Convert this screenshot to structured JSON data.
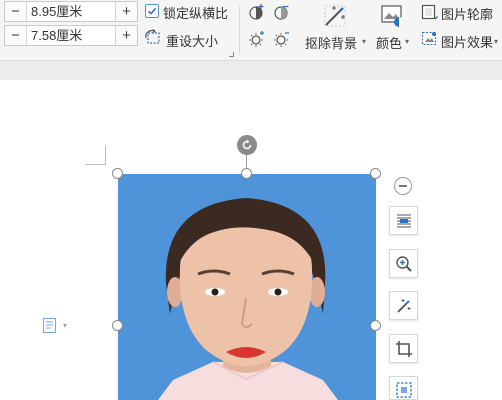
{
  "toolbar": {
    "height_value": "8.95厘米",
    "width_value": "7.58厘米",
    "lock_ratio_label": "锁定纵横比",
    "lock_ratio_checked": true,
    "reset_size_label": "重设大小",
    "remove_bg_label": "抠除背景",
    "color_label": "颜色",
    "outline_label": "图片轮廓",
    "effects_label": "图片效果"
  },
  "colors": {
    "accent": "#2e6fc7",
    "photo_background": "#4f93d8"
  }
}
